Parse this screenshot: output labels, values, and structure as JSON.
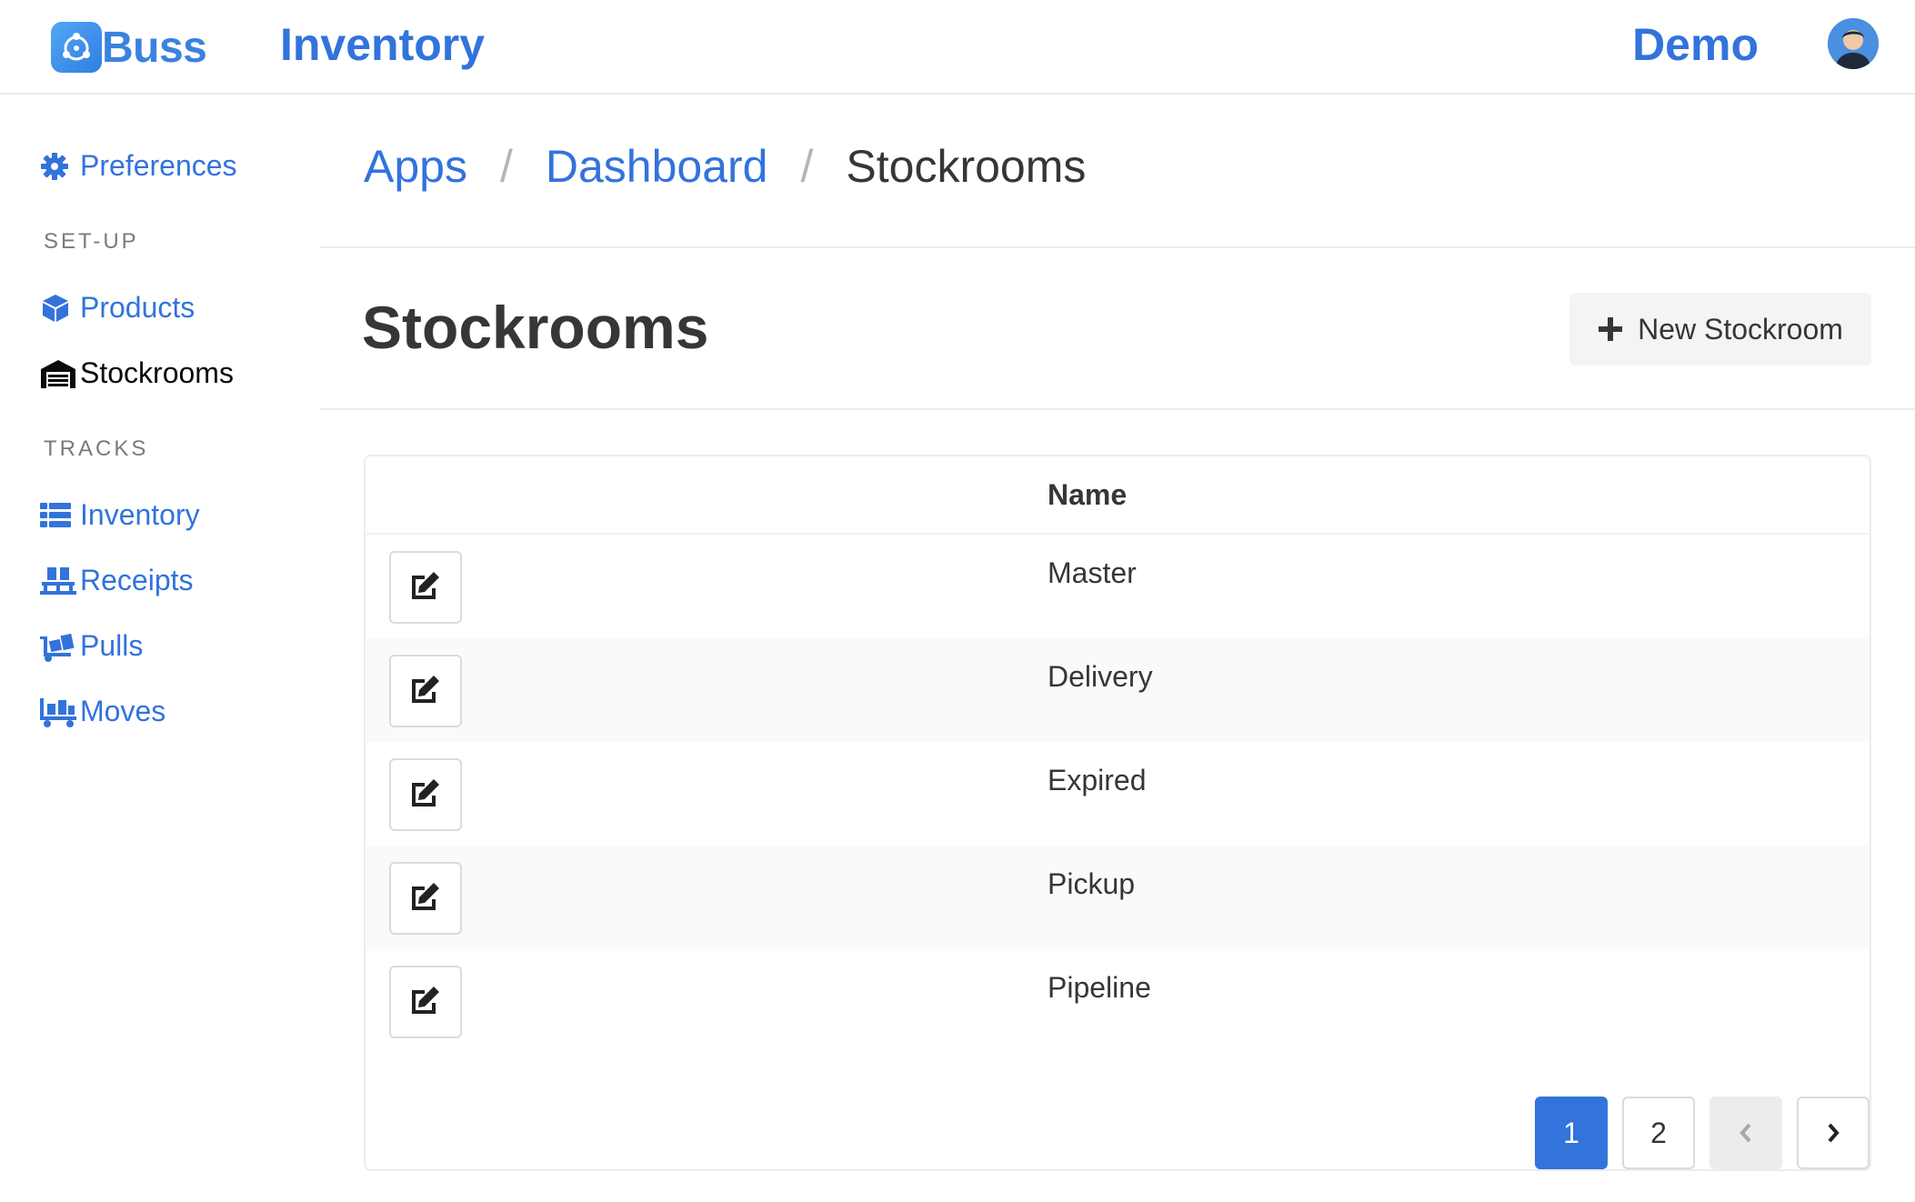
{
  "header": {
    "brand": "Buss",
    "app_title": "Inventory",
    "user_name": "Demo",
    "logo_icon": "network-nodes-icon",
    "avatar_icon": "user-avatar"
  },
  "sidebar": {
    "preferences": {
      "label": "Preferences",
      "icon": "gear-icon"
    },
    "section_setup": "SET-UP",
    "products": {
      "label": "Products",
      "icon": "box-icon"
    },
    "stockrooms": {
      "label": "Stockrooms",
      "icon": "warehouse-icon"
    },
    "section_tracks": "TRACKS",
    "inventory": {
      "label": "Inventory",
      "icon": "list-icon"
    },
    "receipts": {
      "label": "Receipts",
      "icon": "pallet-icon"
    },
    "pulls": {
      "label": "Pulls",
      "icon": "dolly-icon"
    },
    "moves": {
      "label": "Moves",
      "icon": "cart-icon"
    }
  },
  "breadcrumb": {
    "apps": "Apps",
    "dashboard": "Dashboard",
    "current": "Stockrooms",
    "separator": "/"
  },
  "page": {
    "title": "Stockrooms",
    "new_button": "New Stockroom",
    "new_button_icon": "plus-icon"
  },
  "table": {
    "header_name": "Name",
    "rows": [
      "Master",
      "Delivery",
      "Expired",
      "Pickup",
      "Pipeline"
    ]
  },
  "pagination": {
    "pages": [
      "1",
      "2"
    ],
    "current": "1",
    "prev_icon": "chevron-left-icon",
    "next_icon": "chevron-right-icon"
  },
  "colors": {
    "link": "#3273dc",
    "primary": "#3273dc",
    "text": "#363636",
    "muted": "#7a7a7a"
  }
}
